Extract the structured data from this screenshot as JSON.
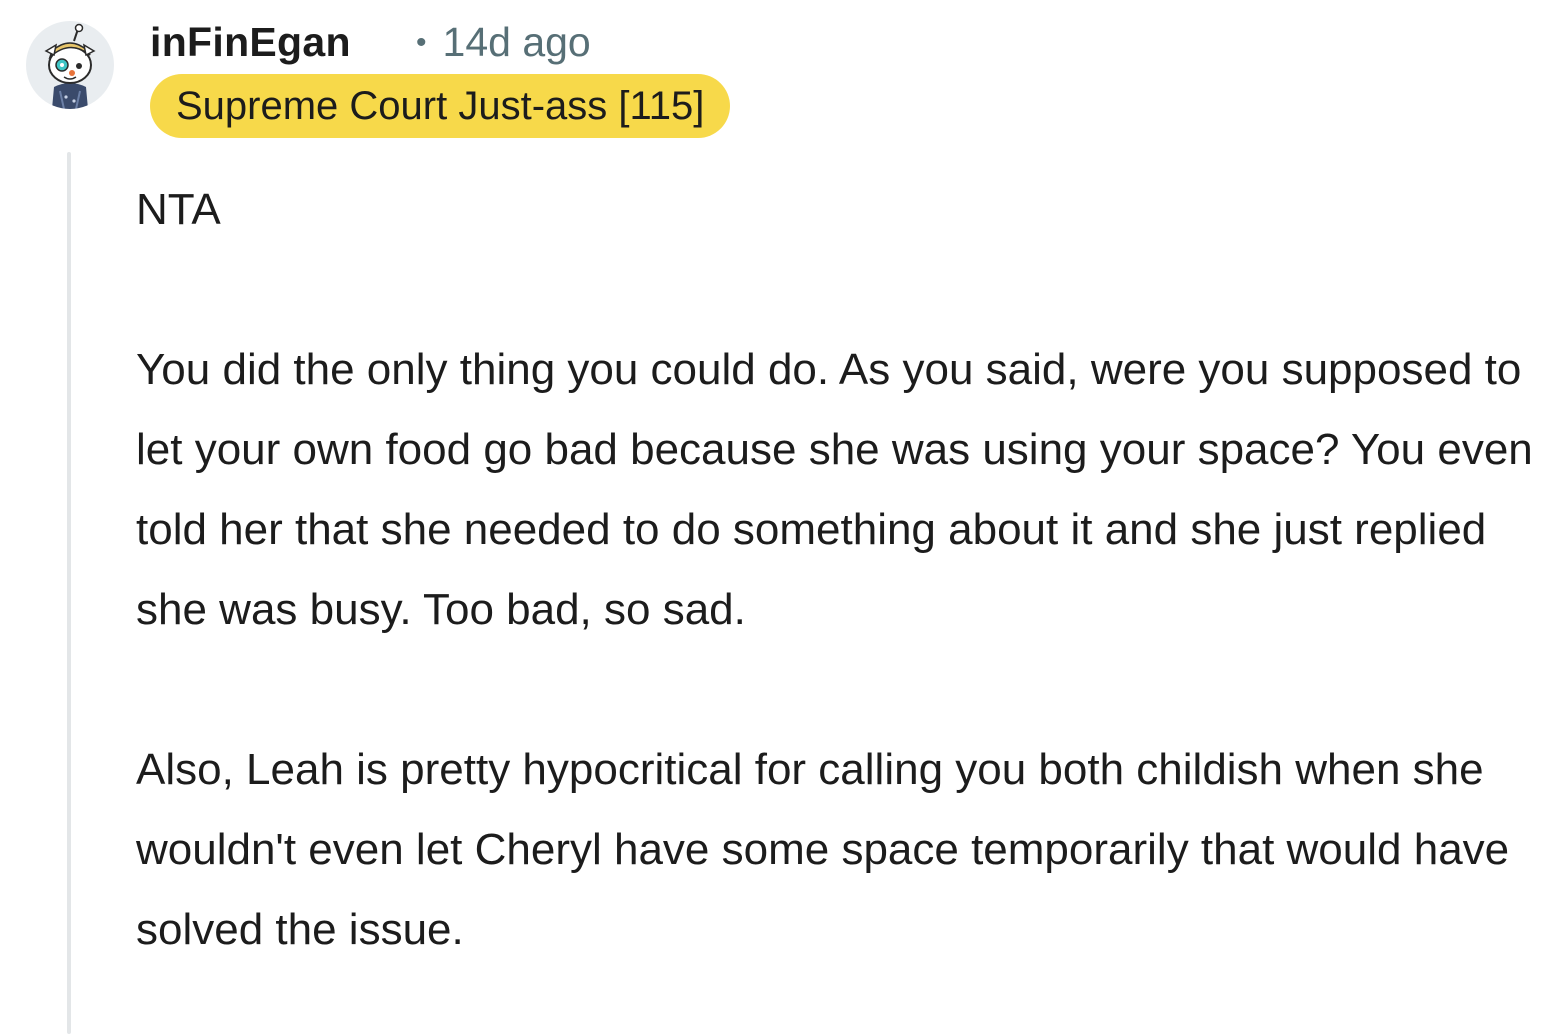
{
  "comment": {
    "author": "inFinEgan",
    "separator": "•",
    "timestamp": "14d ago",
    "flair": "Supreme Court Just-ass [115]",
    "avatar_icon": "snoo-avatar-icon",
    "paragraphs": [
      "NTA",
      "You did the only thing you could do. As you said, were you supposed to let your own food go bad because she was using your space? You even told her that she needed to do something about it and she just replied she was busy. Too bad, so sad.",
      "Also, Leah is pretty hypocritical for calling you both childish when she wouldn't even let Cheryl have some space temporarily that would have solved the issue."
    ]
  },
  "colors": {
    "flair_background": "#f7d94a",
    "meta_text": "#576f76",
    "thread_line": "#e3e6e8",
    "text": "#1c1c1c"
  }
}
